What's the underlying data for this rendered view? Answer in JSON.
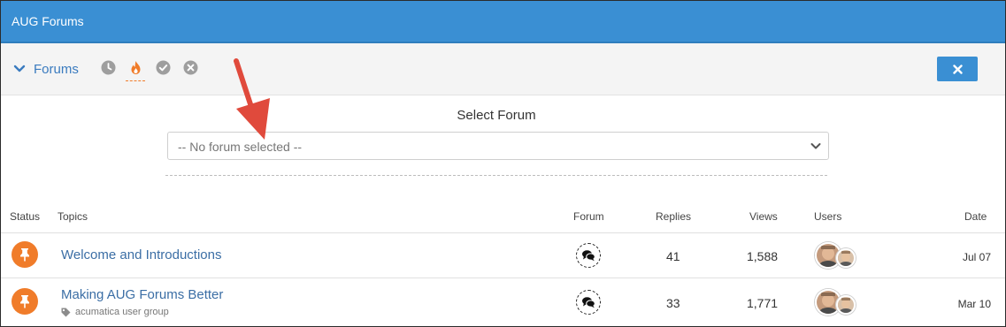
{
  "app": {
    "title": "AUG Forums"
  },
  "toolbar": {
    "forums_label": "Forums",
    "filters": [
      {
        "icon": "clock-icon",
        "color": "#9e9e9e"
      },
      {
        "icon": "fire-icon",
        "color": "#f07c2a",
        "active": true
      },
      {
        "icon": "check-circle-icon",
        "color": "#9e9e9e"
      },
      {
        "icon": "x-circle-icon",
        "color": "#9e9e9e"
      }
    ],
    "close_icon": "close-icon"
  },
  "select_forum": {
    "label": "Select Forum",
    "selected": "-- No forum selected --"
  },
  "table": {
    "headers": {
      "status": "Status",
      "topics": "Topics",
      "forum": "Forum",
      "replies": "Replies",
      "views": "Views",
      "users": "Users",
      "date": "Date"
    },
    "rows": [
      {
        "status_icon": "pin-icon",
        "topic": "Welcome and Introductions",
        "tag": "",
        "forum_icon": "comments-icon",
        "replies": "41",
        "views": "1,588",
        "users": [
          "user-avatar",
          "user-avatar"
        ],
        "date": "Jul 07"
      },
      {
        "status_icon": "pin-icon",
        "topic": "Making AUG Forums Better",
        "tag": "acumatica user group",
        "forum_icon": "comments-icon",
        "replies": "33",
        "views": "1,771",
        "users": [
          "user-avatar",
          "user-avatar"
        ],
        "date": "Mar 10"
      }
    ]
  },
  "colors": {
    "header_bg": "#3a8fd3",
    "accent_orange": "#f07c2a",
    "link": "#3b6ea5",
    "annotation_arrow": "#e04a3c"
  }
}
